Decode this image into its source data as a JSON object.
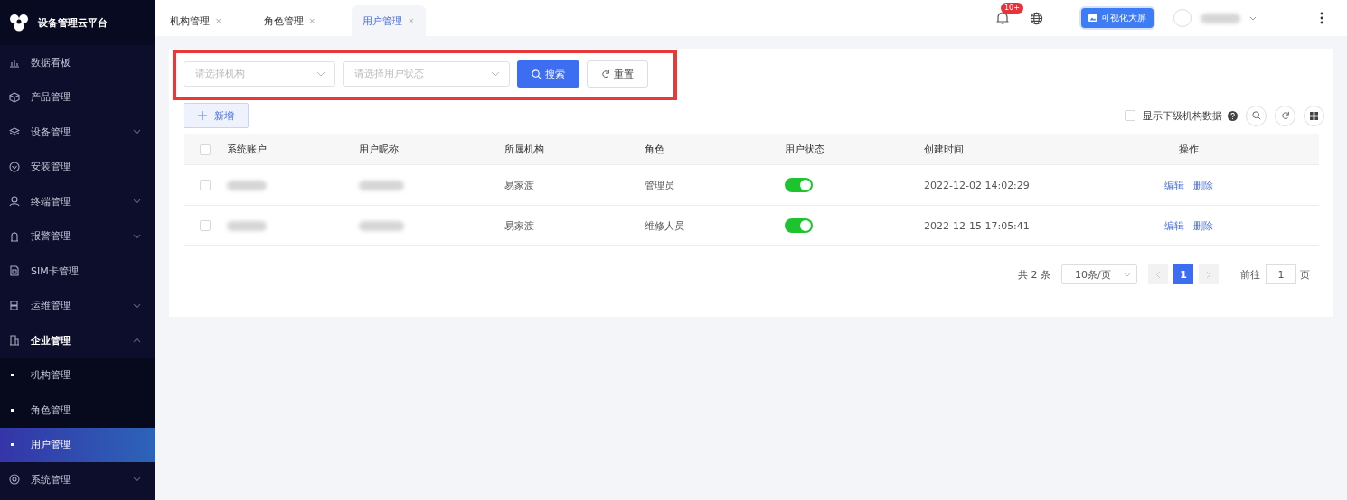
{
  "sidebar": {
    "logo_text": "设备管理云平台",
    "items": [
      {
        "label": "数据看板",
        "selected": false
      },
      {
        "label": "产品管理",
        "selected": false
      },
      {
        "label": "设备管理",
        "selected": false,
        "expanded": false
      },
      {
        "label": "安装管理",
        "selected": false
      },
      {
        "label": "终端管理",
        "selected": false,
        "expanded": false
      },
      {
        "label": "报警管理",
        "selected": false,
        "expanded": false
      },
      {
        "label": "SIM卡管理",
        "selected": false
      },
      {
        "label": "运维管理",
        "selected": false,
        "expanded": false
      },
      {
        "label": "企业管理",
        "selected": false,
        "expanded": true,
        "children": [
          {
            "label": "机构管理",
            "selected": false
          },
          {
            "label": "角色管理",
            "selected": false
          },
          {
            "label": "用户管理",
            "selected": true
          }
        ]
      },
      {
        "label": "系统管理",
        "selected": false,
        "expanded": false
      }
    ]
  },
  "tabs": [
    {
      "label": "机构管理",
      "close": "×",
      "selected": false
    },
    {
      "label": "角色管理",
      "close": "×",
      "selected": false
    },
    {
      "label": "用户管理",
      "close": "×",
      "selected": true
    }
  ],
  "header": {
    "notification_badge": "10+",
    "visualize_button": "可视化大屏"
  },
  "filters": {
    "org_select": {
      "placeholder": "请选择机构"
    },
    "status_select": {
      "placeholder": "请选择用户状态"
    },
    "search_button": "搜索",
    "reset_button": "重置"
  },
  "toolbar": {
    "add_button": "新增",
    "show_sub_org": {
      "label": "显示下级机构数据",
      "checked": false
    }
  },
  "table": {
    "header_checked": false,
    "columns": [
      "系统账户",
      "用户昵称",
      "所属机构",
      "角色",
      "用户状态",
      "创建时间",
      "操作"
    ],
    "rows": [
      {
        "checked": false,
        "organization": "易家渡",
        "role": "管理员",
        "status_on": true,
        "created": "2022-12-02 14:02:29",
        "actions": [
          "编辑",
          "删除"
        ]
      },
      {
        "checked": false,
        "organization": "易家渡",
        "role": "维修人员",
        "status_on": true,
        "created": "2022-12-15 17:05:41",
        "actions": [
          "编辑",
          "删除"
        ]
      }
    ]
  },
  "pagination": {
    "total": "共 2 条",
    "page_size": "10条/页",
    "prev_disabled": true,
    "next_disabled": true,
    "pages": [
      {
        "label": "1",
        "selected": true
      }
    ],
    "goto_label": "前往",
    "goto_value": "1",
    "goto_suffix": "页"
  }
}
